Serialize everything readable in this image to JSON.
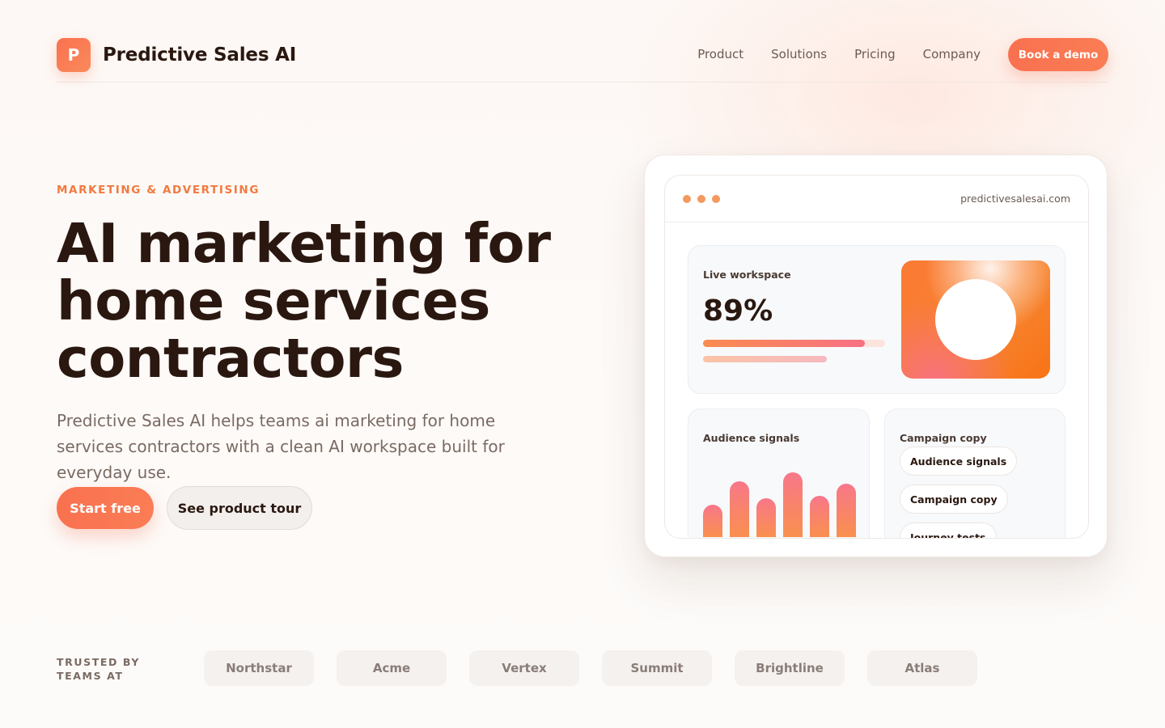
{
  "header": {
    "logo_letter": "P",
    "brand": "Predictive Sales AI",
    "nav": [
      "Product",
      "Solutions",
      "Pricing",
      "Company"
    ],
    "cta": "Book a demo"
  },
  "hero": {
    "eyebrow": "MARKETING & ADVERTISING",
    "title_line1": "AI marketing for",
    "title_line2": "home services",
    "title_line3": "contractors",
    "subtitle": "Predictive Sales AI helps teams ai marketing for home services contractors with a clean AI workspace built for everyday use.",
    "primary_cta": "Start free",
    "secondary_cta": "See product tour"
  },
  "preview": {
    "url": "predictivesalesai.com",
    "live": {
      "label": "Live workspace",
      "metric": "89%",
      "progress": 0.89
    },
    "audience": {
      "label": "Audience signals",
      "bar_levels": [
        0.5,
        0.86,
        0.6,
        1.0,
        0.64,
        0.83
      ]
    },
    "campaign": {
      "label": "Campaign copy",
      "chips": [
        "Audience signals",
        "Campaign copy",
        "Journey tests"
      ]
    }
  },
  "trusted": {
    "label": "TRUSTED BY TEAMS AT",
    "logos": [
      "Northstar",
      "Acme",
      "Vertex",
      "Summit",
      "Brightline",
      "Atlas"
    ]
  },
  "colors": {
    "accent": "#f97150",
    "eyebrow": "#f2793e",
    "text": "#2a1810"
  }
}
